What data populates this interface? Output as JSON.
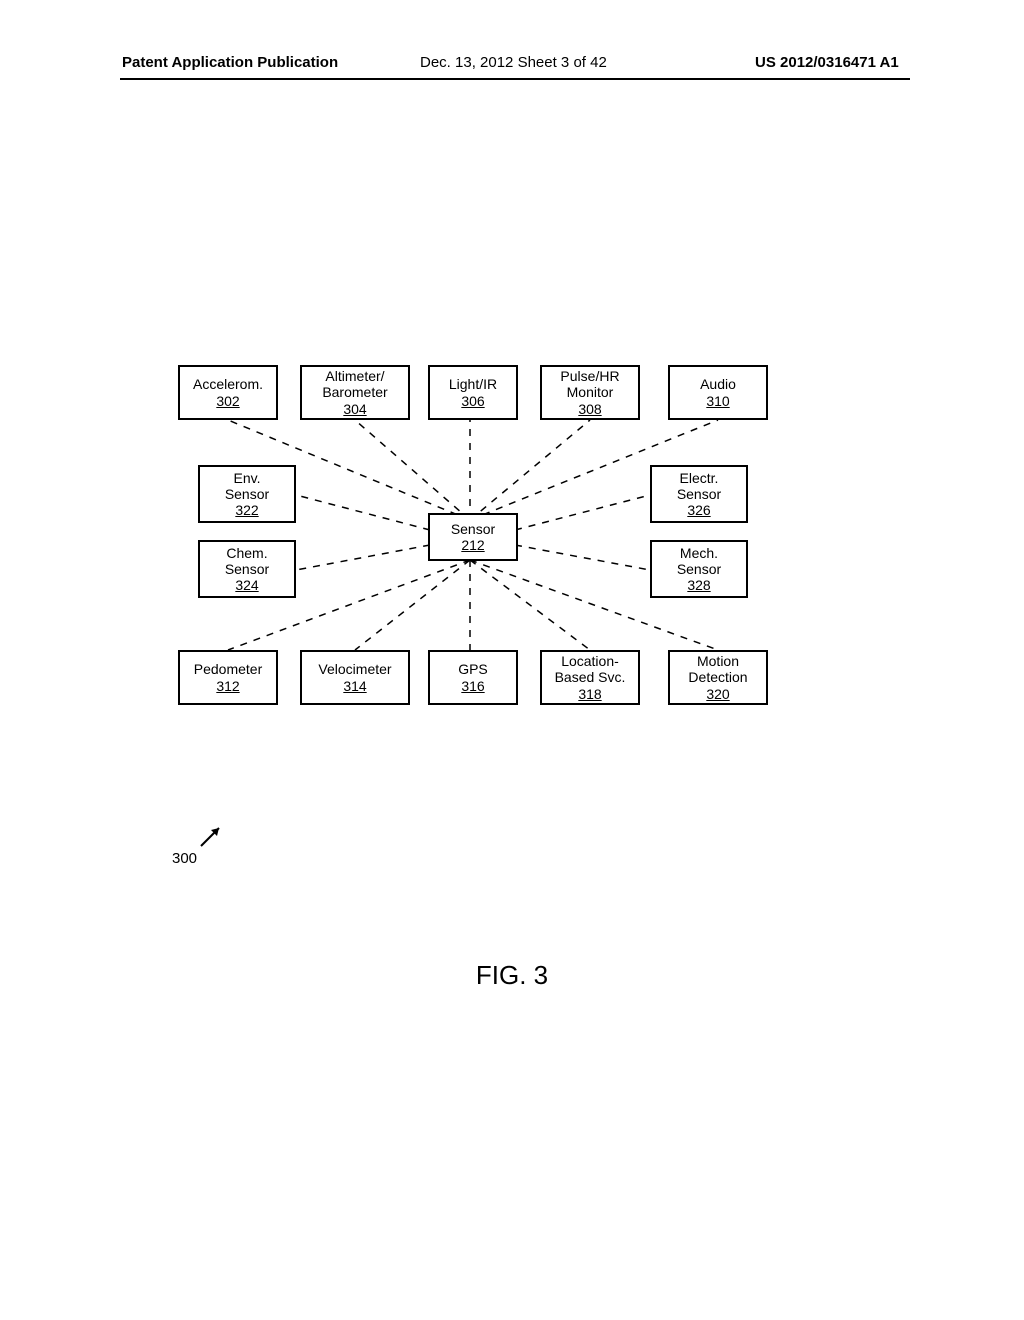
{
  "header": {
    "left": "Patent Application Publication",
    "mid": "Dec. 13, 2012  Sheet 3 of 42",
    "right": "US 2012/0316471 A1"
  },
  "diagram": {
    "center": {
      "label": "Sensor",
      "ref": "212"
    },
    "top": [
      {
        "label": "Accelerom.",
        "ref": "302"
      },
      {
        "label": "Altimeter/\nBarometer",
        "ref": "304"
      },
      {
        "label": "Light/IR",
        "ref": "306"
      },
      {
        "label": "Pulse/HR\nMonitor",
        "ref": "308"
      },
      {
        "label": "Audio",
        "ref": "310"
      }
    ],
    "left": [
      {
        "label": "Env.\nSensor",
        "ref": "322"
      },
      {
        "label": "Chem.\nSensor",
        "ref": "324"
      }
    ],
    "right": [
      {
        "label": "Electr.\nSensor",
        "ref": "326"
      },
      {
        "label": "Mech.\nSensor",
        "ref": "328"
      }
    ],
    "bottom": [
      {
        "label": "Pedometer",
        "ref": "312"
      },
      {
        "label": "Velocimeter",
        "ref": "314"
      },
      {
        "label": "GPS",
        "ref": "316"
      },
      {
        "label": "Location-\nBased Svc.",
        "ref": "318"
      },
      {
        "label": "Motion\nDetection",
        "ref": "320"
      }
    ],
    "overall_ref": "300"
  },
  "figure_label": "FIG. 3"
}
